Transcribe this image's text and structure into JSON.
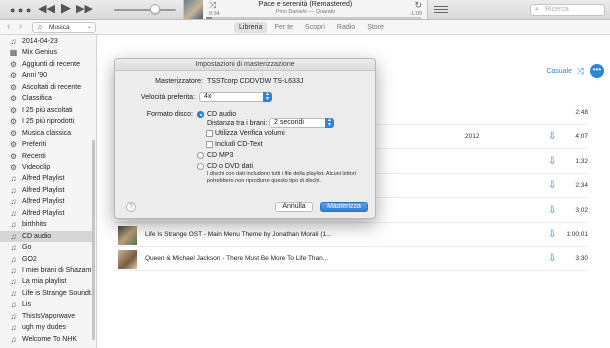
{
  "player": {
    "song_title": "Pace e serenità (Remastered)",
    "song_artist": "Pino Daniele — Quando",
    "elapsed": "0:34",
    "remaining": "-1:09",
    "progress": 0.03,
    "volume": 0.6
  },
  "search": {
    "placeholder": "Ricerca"
  },
  "media_picker": {
    "value": "Musica"
  },
  "tabs": [
    {
      "label": "Libreria",
      "active": true
    },
    {
      "label": "Per te",
      "active": false
    },
    {
      "label": "Scopri",
      "active": false
    },
    {
      "label": "Radio",
      "active": false
    },
    {
      "label": "Store",
      "active": false
    }
  ],
  "sidebar": {
    "items": [
      {
        "label": "2014-04-23",
        "icon": "music-note-icon"
      },
      {
        "label": "Mix Genius",
        "icon": "genius-grid-icon"
      },
      {
        "label": "Aggiunti di recente",
        "icon": "gear-icon"
      },
      {
        "label": "Anni '90",
        "icon": "gear-icon"
      },
      {
        "label": "Ascoltati di recente",
        "icon": "gear-icon"
      },
      {
        "label": "Classifica",
        "icon": "gear-icon"
      },
      {
        "label": "I 25 più ascoltati",
        "icon": "gear-icon"
      },
      {
        "label": "I 25 più riprodotti",
        "icon": "gear-icon"
      },
      {
        "label": "Musica classica",
        "icon": "gear-icon"
      },
      {
        "label": "Preferiti",
        "icon": "gear-icon"
      },
      {
        "label": "Recenti",
        "icon": "gear-icon"
      },
      {
        "label": "Videoclip",
        "icon": "gear-icon"
      },
      {
        "label": "Alfred Playlist",
        "icon": "music-note-icon"
      },
      {
        "label": "Alfred Playlist",
        "icon": "music-note-icon"
      },
      {
        "label": "Alfred Playlist",
        "icon": "music-note-icon"
      },
      {
        "label": "Alfred Playlist",
        "icon": "music-note-icon"
      },
      {
        "label": "birthhits",
        "icon": "music-note-icon"
      },
      {
        "label": "CD audio",
        "icon": "music-note-icon",
        "selected": true
      },
      {
        "label": "Go",
        "icon": "music-note-icon"
      },
      {
        "label": "GO2",
        "icon": "music-note-icon"
      },
      {
        "label": "I miei brani di Shazam",
        "icon": "music-note-icon"
      },
      {
        "label": "La mia playlist",
        "icon": "music-note-icon"
      },
      {
        "label": "Life is Strange Soundt...",
        "icon": "music-note-icon"
      },
      {
        "label": "Lis",
        "icon": "music-note-icon"
      },
      {
        "label": "ThisIsVaporwave",
        "icon": "music-note-icon"
      },
      {
        "label": "ugh my dudes",
        "icon": "music-note-icon"
      },
      {
        "label": "Welcome To NHK",
        "icon": "music-note-icon"
      }
    ]
  },
  "playlist_header": {
    "shuffle_label": "Casuale",
    "more": "•••"
  },
  "rows": [
    {
      "title": "",
      "year": "",
      "duration": "2:48",
      "cloud": false
    },
    {
      "title": "",
      "year": "2012",
      "duration": "4:07",
      "cloud": true
    },
    {
      "title": "",
      "year": "",
      "duration": "1:32",
      "cloud": true
    },
    {
      "title": "",
      "year": "",
      "duration": "2:34",
      "cloud": true
    },
    {
      "title": "",
      "year": "",
      "duration": "3:02",
      "cloud": true
    },
    {
      "title": "Life Is Strange OST - Main Menu Theme by Jonathan Morali (1...",
      "year": "",
      "duration": "1:00:01",
      "cloud": true,
      "art": true
    },
    {
      "title": "Queen & Michael Jackson - There Must Be More To Life Than...",
      "year": "",
      "duration": "3:30",
      "cloud": true,
      "art": true
    }
  ],
  "dialog": {
    "title": "Impostazioni di masterizzazione",
    "burner_label": "Masterizzatore:",
    "burner_value": "TSSTcorp CDDVDW TS-L633J",
    "speed_label": "Velocità preferita:",
    "speed_value": "4x",
    "format_label": "Formato disco:",
    "opt_audio": "CD audio",
    "gap_label": "Distanza tra i brani:",
    "gap_value": "2 secondi",
    "opt_soundcheck": "Utilizza Verifica volumi",
    "opt_cdtext": "Includi CD-Text",
    "opt_mp3": "CD MP3",
    "opt_data": "CD o DVD dati",
    "data_note": "I dischi con dati includono tutti i file della playlist. Alcuni lettori potrebbero non riprodurre questo tipo di dischi.",
    "help": "?",
    "cancel": "Annulla",
    "burn": "Masterizza"
  },
  "colors": {
    "accent": "#2f84d8",
    "selection": "#d6d6d6"
  }
}
